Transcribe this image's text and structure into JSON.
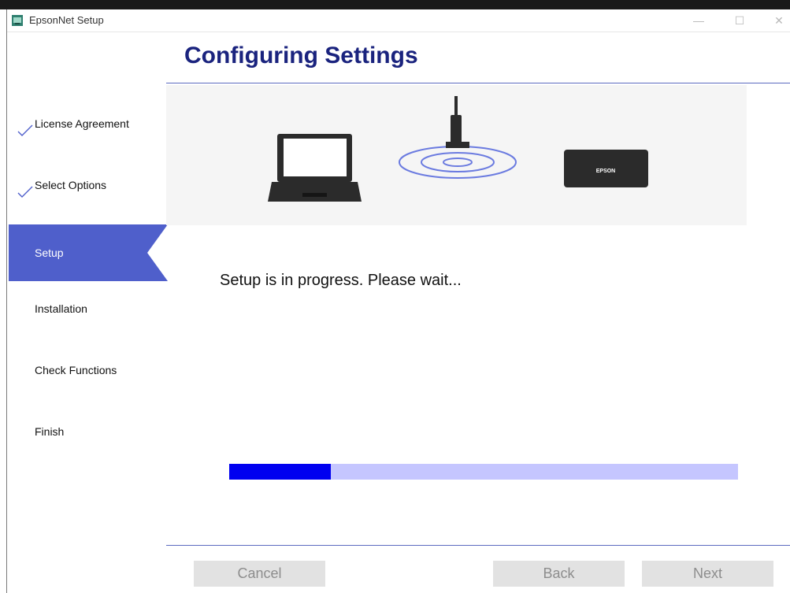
{
  "window": {
    "title": "EpsonNet Setup",
    "controls": {
      "minimize": "—",
      "maximize": "☐",
      "close": "✕"
    }
  },
  "header": {
    "title": "Configuring Settings"
  },
  "sidebar": {
    "steps": [
      {
        "label": "License Agreement",
        "state": "done"
      },
      {
        "label": "Select Options",
        "state": "done"
      },
      {
        "label": "Setup",
        "state": "active"
      },
      {
        "label": "Installation",
        "state": "pending"
      },
      {
        "label": "Check Functions",
        "state": "pending"
      },
      {
        "label": "Finish",
        "state": "pending"
      }
    ]
  },
  "illustration": {
    "icons": [
      "laptop-icon",
      "wireless-router-icon",
      "printer-icon"
    ],
    "printer_brand": "EPSON"
  },
  "main": {
    "status": "Setup is in progress. Please wait...",
    "progress_fraction": 0.2
  },
  "footer": {
    "cancel_label": "Cancel",
    "back_label": "Back",
    "next_label": "Next"
  },
  "colors": {
    "accent": "#4f5fcb",
    "title": "#1a237e",
    "progress_fill": "#0000f0",
    "progress_track": "#c5c6ff"
  }
}
